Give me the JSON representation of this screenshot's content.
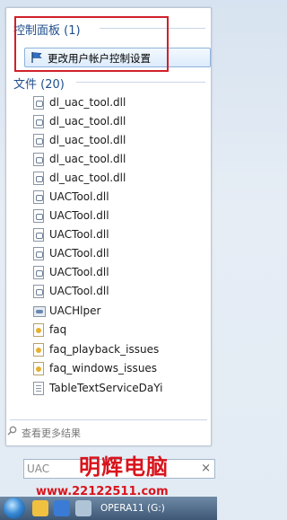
{
  "control_panel": {
    "header": "控制面板 (1)",
    "item_label": "更改用户帐户控制设置",
    "item_icon": "uac-flag-icon"
  },
  "files": {
    "header": "文件 (20)",
    "items": [
      {
        "name": "dl_uac_tool.dll",
        "icon": "dll-file-icon"
      },
      {
        "name": "dl_uac_tool.dll",
        "icon": "dll-file-icon"
      },
      {
        "name": "dl_uac_tool.dll",
        "icon": "dll-file-icon"
      },
      {
        "name": "dl_uac_tool.dll",
        "icon": "dll-file-icon"
      },
      {
        "name": "dl_uac_tool.dll",
        "icon": "dll-file-icon"
      },
      {
        "name": "UACTool.dll",
        "icon": "dll-file-icon"
      },
      {
        "name": "UACTool.dll",
        "icon": "dll-file-icon"
      },
      {
        "name": "UACTool.dll",
        "icon": "dll-file-icon"
      },
      {
        "name": "UACTool.dll",
        "icon": "dll-file-icon"
      },
      {
        "name": "UACTool.dll",
        "icon": "dll-file-icon"
      },
      {
        "name": "UACTool.dll",
        "icon": "dll-file-icon"
      },
      {
        "name": "UACHlper",
        "icon": "exe-file-icon"
      },
      {
        "name": "faq",
        "icon": "faq-file-icon"
      },
      {
        "name": "faq_playback_issues",
        "icon": "faq-file-icon"
      },
      {
        "name": "faq_windows_issues",
        "icon": "faq-file-icon"
      },
      {
        "name": "TableTextServiceDaYi",
        "icon": "text-file-icon"
      }
    ]
  },
  "more_results": "查看更多结果",
  "search": {
    "value": "UAC",
    "close": "×"
  },
  "watermark": {
    "title": "明辉电脑",
    "url": "www.22122511.com"
  },
  "taskbar": {
    "opera_label": "OPERA11 (G:)"
  },
  "colors": {
    "highlight_border": "#d0202a",
    "header_text": "#1f4e8c",
    "watermark": "#d8141c"
  }
}
